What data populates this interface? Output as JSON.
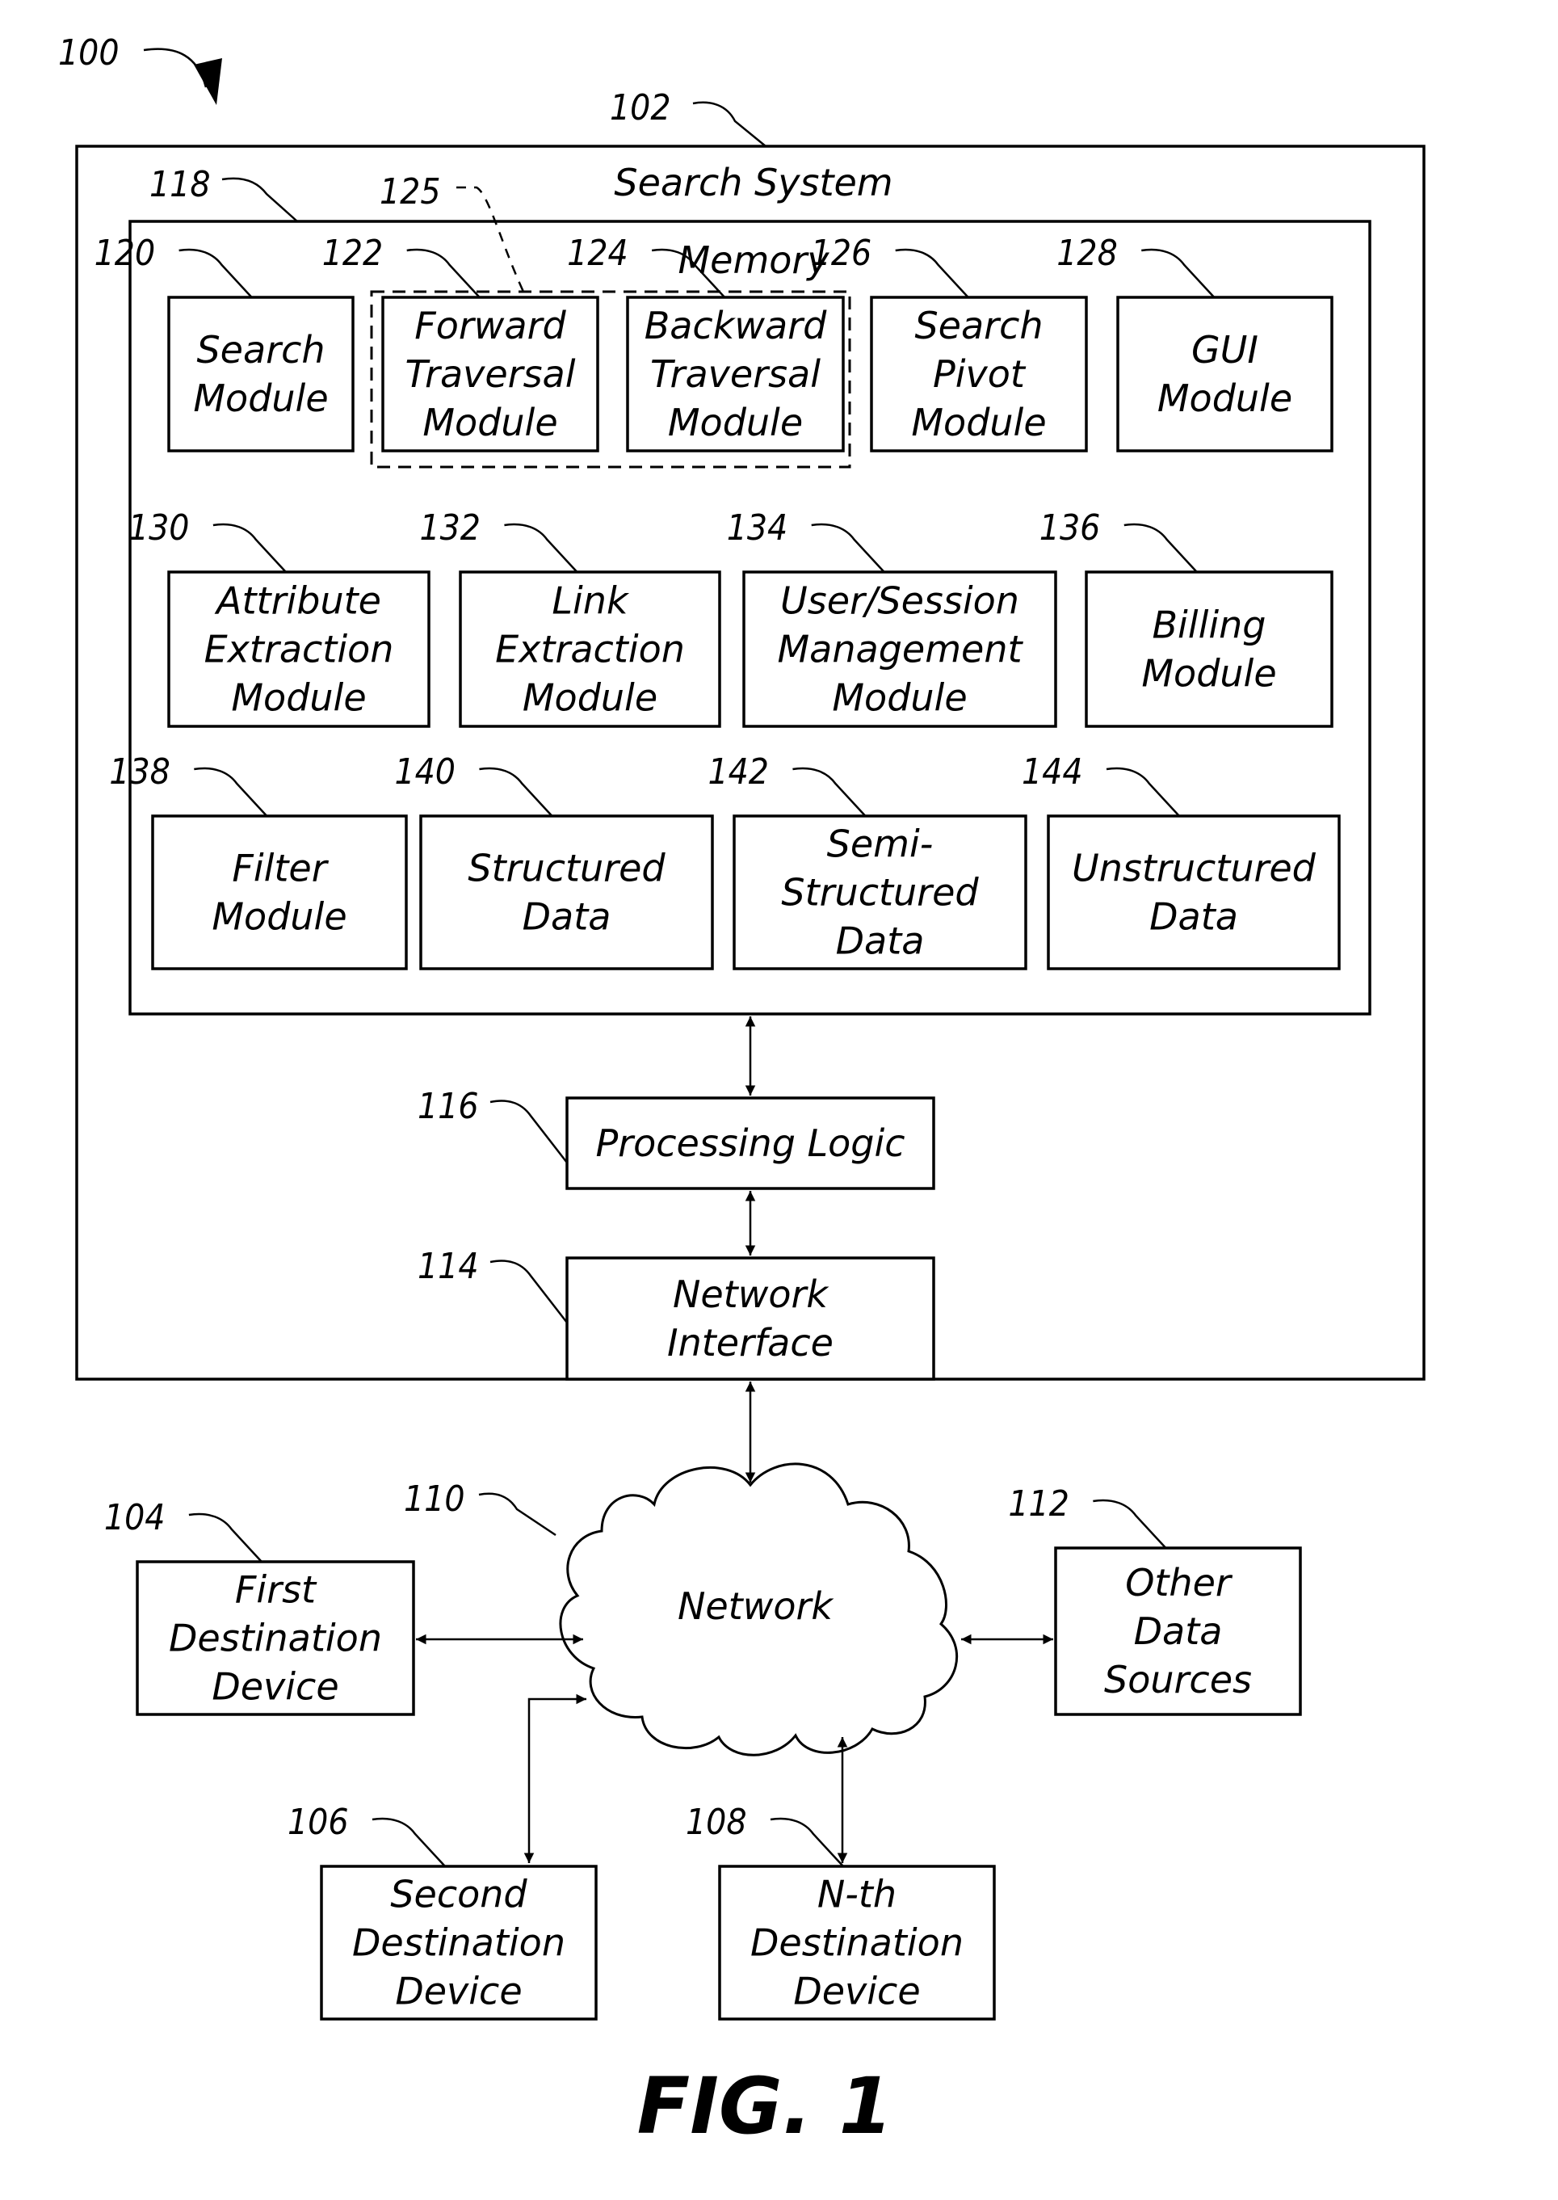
{
  "figure": {
    "ref_overall": "100",
    "caption": "FIG. 1"
  },
  "search_system": {
    "ref": "102",
    "title": "Search System",
    "memory": {
      "ref": "118",
      "title": "Memory",
      "group_ref": "125",
      "modules": [
        {
          "ref": "120",
          "lines": [
            "Search",
            "Module"
          ]
        },
        {
          "ref": "122",
          "lines": [
            "Forward",
            "Traversal",
            "Module"
          ]
        },
        {
          "ref": "124",
          "lines": [
            "Backward",
            "Traversal",
            "Module"
          ]
        },
        {
          "ref": "126",
          "lines": [
            "Search",
            "Pivot",
            "Module"
          ]
        },
        {
          "ref": "128",
          "lines": [
            "GUI",
            "Module"
          ]
        },
        {
          "ref": "130",
          "lines": [
            "Attribute",
            "Extraction",
            "Module"
          ]
        },
        {
          "ref": "132",
          "lines": [
            "Link",
            "Extraction",
            "Module"
          ]
        },
        {
          "ref": "134",
          "lines": [
            "User/Session",
            "Management",
            "Module"
          ]
        },
        {
          "ref": "136",
          "lines": [
            "Billing",
            "Module"
          ]
        },
        {
          "ref": "138",
          "lines": [
            "Filter",
            "Module"
          ]
        },
        {
          "ref": "140",
          "lines": [
            "Structured",
            "Data"
          ]
        },
        {
          "ref": "142",
          "lines": [
            "Semi-",
            "Structured",
            "Data"
          ]
        },
        {
          "ref": "144",
          "lines": [
            "Unstructured",
            "Data"
          ]
        }
      ]
    },
    "processing_logic": {
      "ref": "116",
      "lines": [
        "Processing Logic"
      ]
    },
    "network_interface": {
      "ref": "114",
      "lines": [
        "Network",
        "Interface"
      ]
    }
  },
  "network": {
    "ref": "110",
    "label": "Network"
  },
  "external": [
    {
      "ref": "104",
      "lines": [
        "First",
        "Destination",
        "Device"
      ]
    },
    {
      "ref": "112",
      "lines": [
        "Other",
        "Data",
        "Sources"
      ]
    },
    {
      "ref": "106",
      "lines": [
        "Second",
        "Destination",
        "Device"
      ]
    },
    {
      "ref": "108",
      "lines": [
        "N-th",
        "Destination",
        "Device"
      ]
    }
  ]
}
